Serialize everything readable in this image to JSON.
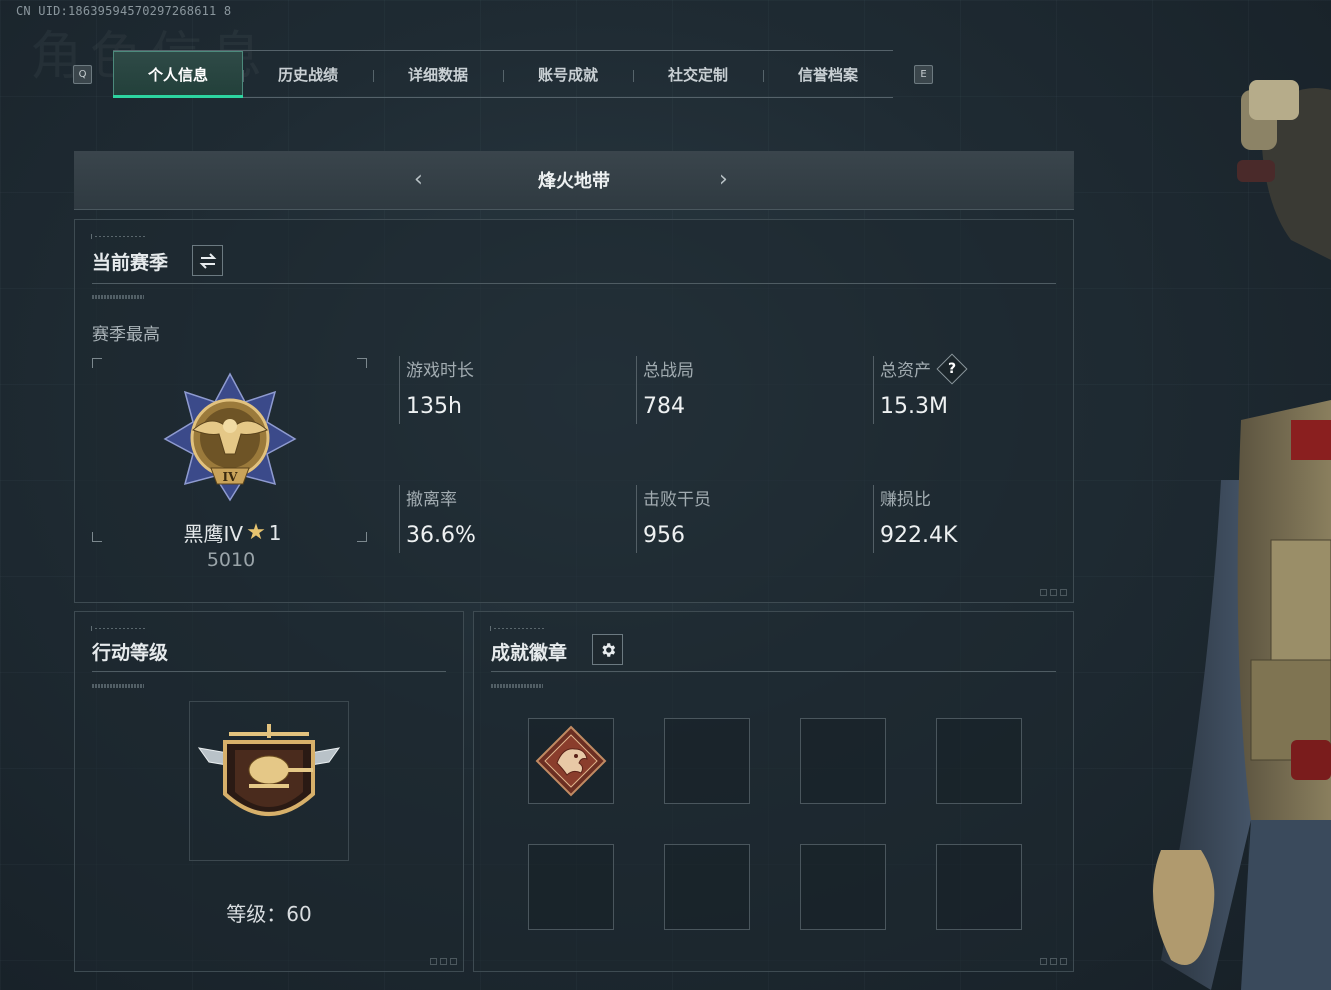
{
  "uid_text": "CN UID:18639594570297268611 8",
  "watermark": "角色信息",
  "tabs": {
    "left_key": "Q",
    "right_key": "E",
    "items": [
      {
        "label": "个人信息",
        "active": true
      },
      {
        "label": "历史战绩",
        "active": false
      },
      {
        "label": "详细数据",
        "active": false
      },
      {
        "label": "账号成就",
        "active": false
      },
      {
        "label": "社交定制",
        "active": false
      },
      {
        "label": "信誉档案",
        "active": false
      }
    ]
  },
  "mode": {
    "title": "烽火地带",
    "prev_icon": "chevron-left-icon",
    "next_icon": "chevron-right-icon"
  },
  "season": {
    "title": "当前赛季",
    "switch_icon": "swap-icon",
    "highest_label": "赛季最高",
    "rank_name": "黑鹰IV",
    "rank_star_count": "1",
    "rank_points": "5010",
    "stats": [
      {
        "label": "游戏时长",
        "value": "135h"
      },
      {
        "label": "总战局",
        "value": "784"
      },
      {
        "label": "总资产",
        "value": "15.3M",
        "help": "?"
      },
      {
        "label": "撤离率",
        "value": "36.6%"
      },
      {
        "label": "击败干员",
        "value": "956"
      },
      {
        "label": "赚损比",
        "value": "922.4K"
      }
    ]
  },
  "action_level": {
    "title": "行动等级",
    "level_label": "等级：",
    "level_value": "60"
  },
  "badges": {
    "title": "成就徽章",
    "settings_icon": "gear-icon",
    "slots_filled": 1,
    "slots_total": 8
  },
  "colors": {
    "accent": "#2dd4a0",
    "gold": "#c9a35a"
  }
}
